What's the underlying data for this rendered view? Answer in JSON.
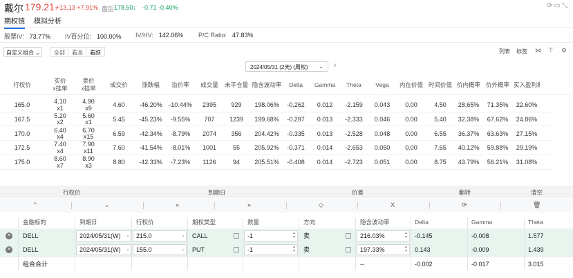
{
  "header": {
    "name": "戴尔",
    "price": "179.21",
    "price_arrow": "↑",
    "change": "+13.13 +7.91%",
    "after_label": "盘后",
    "after_price": "178.50",
    "after_arrow": "↓",
    "after_change": "-0.71 -0.40%"
  },
  "tabs": {
    "chain": "期权链",
    "sim": "模拟分析"
  },
  "stats": {
    "iv_label": "股票IV:",
    "iv": "73.77%",
    "ivp_label": "IV百分位:",
    "ivp": "100.00%",
    "ivhv_label": "IV/HV:",
    "ivhv": "142.06%",
    "pcr_label": "P/C Ratio:",
    "pcr": "47.83%"
  },
  "toolbar": {
    "combo": "自定义组合",
    "seg_all": "全部",
    "seg_rise": "看涨",
    "seg_fall": "看跌",
    "list": "列表",
    "tag": "标签"
  },
  "expiry": {
    "value": "2024/05/31 (2天) (周权)"
  },
  "chain_headers": [
    "行权价",
    "买价\nx挂单",
    "卖价\nx挂单",
    "成交价",
    "涨跌幅",
    "溢价率",
    "成交量",
    "未平仓量",
    "隐含波动率",
    "Delta",
    "Gamma",
    "Theta",
    "Vega",
    "内在价值",
    "时间价值",
    "价内概率",
    "价外概率",
    "买入盈利概率"
  ],
  "chain_rows": [
    {
      "strike": "165.0",
      "bid": "4.10",
      "bidx": "x1",
      "ask": "4.90",
      "askx": "x9",
      "last": "4.60",
      "chg": "-46.20%",
      "prem": "-10.44%",
      "vol": "2395",
      "oi": "929",
      "iv": "198.06%",
      "delta": "-0.262",
      "gamma": "0.012",
      "theta": "-2.159",
      "vega": "0.043",
      "intr": "0.00",
      "timev": "4.50",
      "itm": "28.65%",
      "otm": "71.35%",
      "prof": "22.60%"
    },
    {
      "strike": "167.5",
      "bid": "5.20",
      "bidx": "x2",
      "ask": "5.60",
      "askx": "x1",
      "last": "5.45",
      "chg": "-45.23%",
      "prem": "-9.55%",
      "vol": "707",
      "oi": "1239",
      "iv": "199.68%",
      "delta": "-0.297",
      "gamma": "0.013",
      "theta": "-2.333",
      "vega": "0.046",
      "intr": "0.00",
      "timev": "5.40",
      "itm": "32.38%",
      "otm": "67.62%",
      "prof": "24.86%"
    },
    {
      "strike": "170.0",
      "bid": "6.40",
      "bidx": "x4",
      "ask": "6.70",
      "askx": "x15",
      "last": "6.59",
      "chg": "-42.34%",
      "prem": "-8.79%",
      "vol": "2074",
      "oi": "356",
      "iv": "204.42%",
      "delta": "-0.335",
      "gamma": "0.013",
      "theta": "-2.528",
      "vega": "0.048",
      "intr": "0.00",
      "timev": "6.55",
      "itm": "36.37%",
      "otm": "63.63%",
      "prof": "27.15%"
    },
    {
      "strike": "172.5",
      "bid": "7.40",
      "bidx": "x4",
      "ask": "7.90",
      "askx": "x11",
      "last": "7.60",
      "chg": "-41.54%",
      "prem": "-8.01%",
      "vol": "1001",
      "oi": "55",
      "iv": "205.92%",
      "delta": "-0.371",
      "gamma": "0.014",
      "theta": "-2.653",
      "vega": "0.050",
      "intr": "0.00",
      "timev": "7.65",
      "itm": "40.12%",
      "otm": "59.88%",
      "prof": "29.19%"
    },
    {
      "strike": "175.0",
      "bid": "8.60",
      "bidx": "x7",
      "ask": "8.90",
      "askx": "x3",
      "last": "8.80",
      "chg": "-42.33%",
      "prem": "-7.23%",
      "vol": "1126",
      "oi": "94",
      "iv": "205.51%",
      "delta": "-0.408",
      "gamma": "0.014",
      "theta": "-2.723",
      "vega": "0.051",
      "intr": "0.00",
      "timev": "8.75",
      "itm": "43.79%",
      "otm": "56.21%",
      "prof": "31.08%"
    }
  ],
  "controls": {
    "strike": "行权价",
    "expiry": "到期日",
    "price": "价差",
    "flip": "翻转",
    "clear": "清空",
    "b1": "≈",
    "b2": "≈",
    "b3": "«",
    "b4": "»",
    "b5": "◇",
    "b6": "X",
    "b7": "⟳",
    "b8": "🗑"
  },
  "legs_headers": [
    "金融标的",
    "到期日",
    "行权价",
    "期权类型",
    "数量",
    "方向",
    "隐含波动率",
    "Delta",
    "Gamma",
    "Theta"
  ],
  "legs": [
    {
      "underlying": "DELL",
      "expiry": "2024/05/31(W)",
      "strike": "215.0",
      "type": "CALL",
      "qty": "-1",
      "dir": "卖",
      "iv": "216.03%",
      "delta": "-0.145",
      "gamma": "-0.008",
      "theta": "1.577"
    },
    {
      "underlying": "DELL",
      "expiry": "2024/05/31(W)",
      "strike": "155.0",
      "type": "PUT",
      "qty": "-1",
      "dir": "卖",
      "iv": "197.33%",
      "delta": "0.143",
      "gamma": "-0.009",
      "theta": "1.439"
    }
  ],
  "total": {
    "label": "组合合计",
    "iv": "--",
    "delta": "-0.002",
    "gamma": "-0.017",
    "theta": "3.015"
  },
  "colors": {
    "up": "#e0443a",
    "down": "#19a15f",
    "accent": "#2a6fdb",
    "leg_bg": "#e7f5ee"
  }
}
